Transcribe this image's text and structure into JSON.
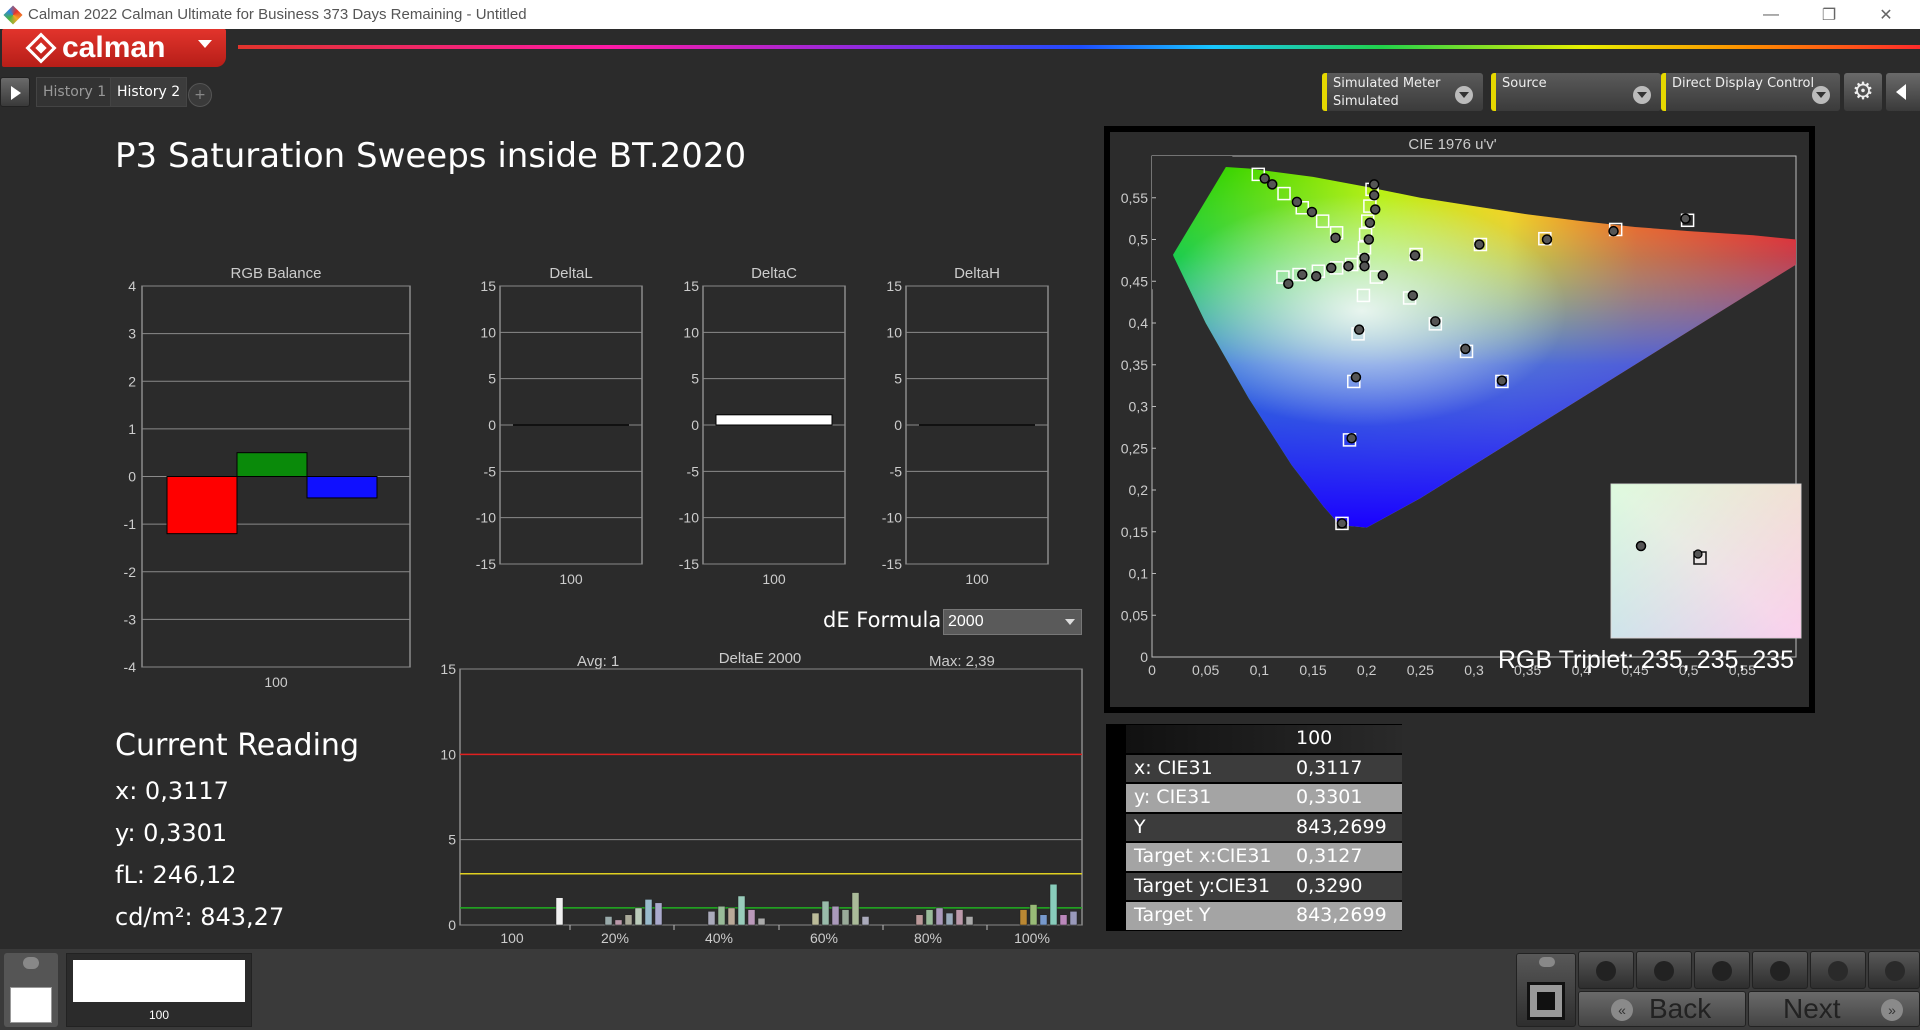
{
  "window": {
    "title": "Calman 2022 Calman Ultimate for Business 373 Days Remaining  - Untitled",
    "minimize": "—",
    "restore": "❐",
    "close": "✕"
  },
  "brand": {
    "logo_text": "calman"
  },
  "tabs": [
    {
      "label": "History 1",
      "active": false
    },
    {
      "label": "History 2",
      "active": true
    }
  ],
  "add_tab": "+",
  "toolbar": {
    "meter": {
      "line1": "Simulated Meter",
      "line2": "Simulated"
    },
    "source": {
      "line1": "Source"
    },
    "display": {
      "line1": "Direct Display Control"
    },
    "settings_icon": "⚙"
  },
  "page_title": "P3 Saturation Sweeps inside BT.2020",
  "rgb_balance": {
    "title": "RGB Balance",
    "y_ticks": [
      "4",
      "3",
      "2",
      "1",
      "0",
      "-1",
      "-2",
      "-3",
      "-4"
    ],
    "x_label": "100",
    "values": {
      "red": -1.2,
      "green": 0.5,
      "blue": -0.45
    },
    "colors": {
      "red": "#ff0000",
      "green": "#0a8a0a",
      "blue": "#1010ff"
    }
  },
  "small_charts": [
    {
      "title": "DeltaL",
      "x_label": "100",
      "value": 0
    },
    {
      "title": "DeltaC",
      "x_label": "100",
      "value": 1.1
    },
    {
      "title": "DeltaH",
      "x_label": "100",
      "value": 0
    }
  ],
  "small_y_ticks": [
    "15",
    "10",
    "5",
    "0",
    "-5",
    "-10",
    "-15"
  ],
  "de_formula": {
    "label": "dE Formula:",
    "value": "2000"
  },
  "deltae_chart": {
    "title": "DeltaE 2000",
    "avg": "Avg: 1",
    "max": "Max: 2,39",
    "y_ticks": [
      "15",
      "10",
      "5",
      "0"
    ],
    "x_ticks": [
      "100",
      "20%",
      "40%",
      "60%",
      "80%",
      "100%"
    ],
    "red_line": 10,
    "yellow_line": 3,
    "green_line": 1,
    "bar_groups": [
      [
        1.6
      ],
      [
        0.5,
        0.3,
        0.6,
        1.0,
        1.5,
        1.3
      ],
      [
        0.8,
        1.1,
        1.0,
        1.7,
        0.9,
        0.4
      ],
      [
        0.7,
        1.4,
        1.1,
        0.9,
        1.9,
        0.5
      ],
      [
        0.6,
        0.9,
        1.0,
        0.7,
        0.9,
        0.5
      ],
      [
        0.9,
        1.2,
        0.6,
        2.39,
        0.6,
        0.8
      ]
    ],
    "bar_colors": [
      "#e6e6e6",
      "#cfcfcf",
      "#a8a8a8",
      "#8a8a8a",
      "#6f6f6f",
      "#5a5a5a"
    ]
  },
  "current_reading": {
    "heading": "Current Reading",
    "x": "x: 0,3117",
    "y": "y: 0,3301",
    "fl": "fL: 246,12",
    "cdm2": "cd/m²: 843,27"
  },
  "cie": {
    "title": "CIE 1976 u'v'",
    "x_ticks": [
      "0",
      "0,05",
      "0,1",
      "0,15",
      "0,2",
      "0,25",
      "0,3",
      "0,35",
      "0,4",
      "0,45",
      "0,5",
      "0,55"
    ],
    "y_ticks": [
      "0,55",
      "0,5",
      "0,45",
      "0,4",
      "0,35",
      "0,3",
      "0,25",
      "0,2",
      "0,15",
      "0,1",
      "0,05",
      "0"
    ],
    "rgb_triplet": "RGB Triplet: 235, 235, 235",
    "targets": [
      [
        0.099,
        0.578
      ],
      [
        0.123,
        0.555
      ],
      [
        0.14,
        0.538
      ],
      [
        0.159,
        0.522
      ],
      [
        0.172,
        0.508
      ],
      [
        0.205,
        0.56
      ],
      [
        0.203,
        0.54
      ],
      [
        0.201,
        0.522
      ],
      [
        0.199,
        0.506
      ],
      [
        0.198,
        0.49
      ],
      [
        0.197,
        0.473
      ],
      [
        0.246,
        0.482
      ],
      [
        0.306,
        0.494
      ],
      [
        0.366,
        0.501
      ],
      [
        0.432,
        0.512
      ],
      [
        0.499,
        0.523
      ],
      [
        0.122,
        0.455
      ],
      [
        0.137,
        0.458
      ],
      [
        0.155,
        0.462
      ],
      [
        0.172,
        0.466
      ],
      [
        0.186,
        0.47
      ],
      [
        0.197,
        0.433
      ],
      [
        0.209,
        0.455
      ],
      [
        0.24,
        0.43
      ],
      [
        0.264,
        0.399
      ],
      [
        0.293,
        0.366
      ],
      [
        0.326,
        0.33
      ],
      [
        0.192,
        0.387
      ],
      [
        0.188,
        0.33
      ],
      [
        0.184,
        0.26
      ],
      [
        0.177,
        0.16
      ]
    ],
    "measured": [
      [
        0.105,
        0.573
      ],
      [
        0.112,
        0.566
      ],
      [
        0.135,
        0.545
      ],
      [
        0.149,
        0.533
      ],
      [
        0.171,
        0.502
      ],
      [
        0.207,
        0.566
      ],
      [
        0.207,
        0.553
      ],
      [
        0.208,
        0.536
      ],
      [
        0.203,
        0.52
      ],
      [
        0.202,
        0.5
      ],
      [
        0.245,
        0.481
      ],
      [
        0.305,
        0.494
      ],
      [
        0.368,
        0.5
      ],
      [
        0.43,
        0.51
      ],
      [
        0.497,
        0.525
      ],
      [
        0.127,
        0.447
      ],
      [
        0.14,
        0.458
      ],
      [
        0.153,
        0.456
      ],
      [
        0.167,
        0.466
      ],
      [
        0.183,
        0.468
      ],
      [
        0.198,
        0.478
      ],
      [
        0.215,
        0.457
      ],
      [
        0.243,
        0.433
      ],
      [
        0.264,
        0.402
      ],
      [
        0.292,
        0.369
      ],
      [
        0.326,
        0.331
      ],
      [
        0.193,
        0.392
      ],
      [
        0.19,
        0.335
      ],
      [
        0.186,
        0.262
      ],
      [
        0.177,
        0.16
      ],
      [
        0.198,
        0.468
      ]
    ]
  },
  "reading_table": {
    "header": "100",
    "rows": [
      {
        "k": "x: CIE31",
        "v": "0,3117"
      },
      {
        "k": "y: CIE31",
        "v": "0,3301"
      },
      {
        "k": "Y",
        "v": "843,2699"
      },
      {
        "k": "Target x:CIE31",
        "v": "0,3127"
      },
      {
        "k": "Target y:CIE31",
        "v": "0,3290"
      },
      {
        "k": "Target Y",
        "v": "843,2699"
      }
    ]
  },
  "bottom": {
    "patch_label": "100",
    "back": "Back",
    "next": "Next",
    "back_icon": "«",
    "next_icon": "»"
  }
}
